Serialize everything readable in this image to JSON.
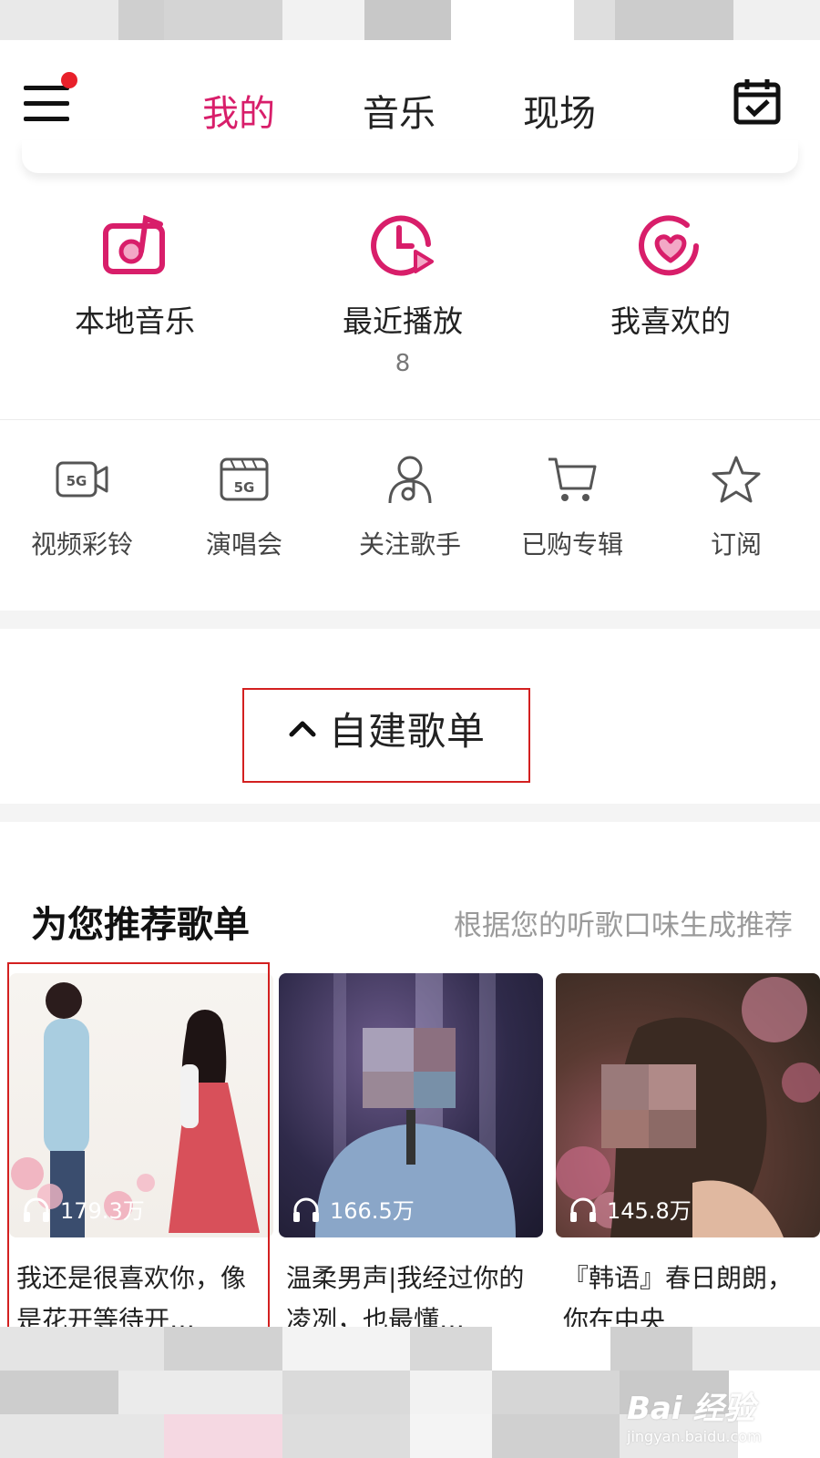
{
  "top_nav": {
    "tabs": [
      {
        "label": "我的",
        "active": true
      },
      {
        "label": "音乐",
        "active": false
      },
      {
        "label": "现场",
        "active": false
      }
    ],
    "menu_icon": "hamburger-menu-icon",
    "notification_dot": true,
    "calendar_icon": "calendar-check-icon",
    "accent_color": "#d81e6a"
  },
  "main_features": [
    {
      "label": "本地音乐",
      "icon": "local-music-icon",
      "count": ""
    },
    {
      "label": "最近播放",
      "icon": "recent-play-icon",
      "count": "8"
    },
    {
      "label": "我喜欢的",
      "icon": "heart-icon",
      "count": ""
    }
  ],
  "secondary_features": [
    {
      "label": "视频彩铃",
      "icon": "5g-video-icon"
    },
    {
      "label": "演唱会",
      "icon": "5g-concert-icon"
    },
    {
      "label": "关注歌手",
      "icon": "followed-singer-icon"
    },
    {
      "label": "已购专辑",
      "icon": "cart-icon"
    },
    {
      "label": "订阅",
      "icon": "star-icon"
    }
  ],
  "playlist_section": {
    "label": "自建歌单",
    "icon": "chevron-up-icon"
  },
  "recommend": {
    "title": "为您推荐歌单",
    "subtitle": "根据您的听歌口味生成推荐",
    "cards": [
      {
        "plays": "179.3万",
        "title": "我还是很喜欢你，像是花开等待开…"
      },
      {
        "plays": "166.5万",
        "title": "温柔男声|我经过你的凌冽，也最懂…"
      },
      {
        "plays": "145.8万",
        "title": "『韩语』春日朗朗，你在中央"
      }
    ]
  },
  "watermark": {
    "logo": "Bai 经验",
    "url": "jingyan.baidu.com"
  }
}
